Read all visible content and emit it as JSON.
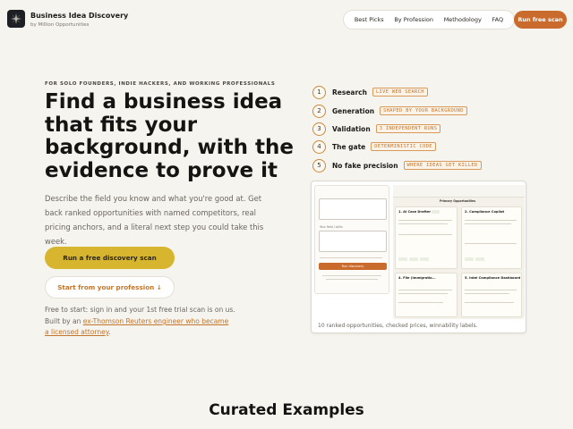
{
  "header": {
    "brand_title": "Business Idea Discovery",
    "brand_subtitle": "by Million Opportunities",
    "nav": [
      "Best Picks",
      "By Profession",
      "Methodology",
      "FAQ"
    ],
    "cta": "Run free scan"
  },
  "hero": {
    "eyebrow": "FOR SOLO FOUNDERS, INDIE HACKERS, AND WORKING PROFESSIONALS",
    "title": "Find a business idea that fits your background, with the evidence to prove it",
    "description": "Describe the field you know and what you're good at. Get back ranked opportunities with named competitors, real pricing anchors, and a literal next step you could take this week.",
    "primary_button": "Run a free discovery scan",
    "secondary_button": "Start from your profession ↓",
    "free_note": "Free to start: sign in and your 1st free trial scan is on us.",
    "built_by_prefix": "Built by an ",
    "built_by_link": "ex-Thomson Reuters engineer who became a licensed attorney",
    "built_by_suffix": "."
  },
  "steps": [
    {
      "num": "1",
      "label": "Research",
      "tag": "LIVE WEB SEARCH"
    },
    {
      "num": "2",
      "label": "Generation",
      "tag": "SHAPED BY YOUR BACKGROUND"
    },
    {
      "num": "3",
      "label": "Validation",
      "tag": "3 INDEPENDENT RUNS"
    },
    {
      "num": "4",
      "label": "The gate",
      "tag": "DETERMINISTIC CODE"
    },
    {
      "num": "5",
      "label": "No fake precision",
      "tag": "WHERE IDEAS GET KILLED"
    }
  ],
  "preview": {
    "caption": "10 ranked opportunities, checked prices, winnability labels.",
    "panel_title": "Primary Opportunities",
    "cards": [
      {
        "title": "1. AI Case Drafter"
      },
      {
        "title": "2. Compliance Copilot"
      },
      {
        "title": "4. File (Immigratio..."
      },
      {
        "title": "5. Intel Compliance Dashboard"
      }
    ],
    "form_label": "Your field / skills",
    "form_button": "Run discovery"
  },
  "section": {
    "title": "Curated Examples"
  },
  "colors": {
    "accent": "#c96b2c",
    "primary_button": "#d8b52e",
    "background": "#f6f4ef"
  }
}
